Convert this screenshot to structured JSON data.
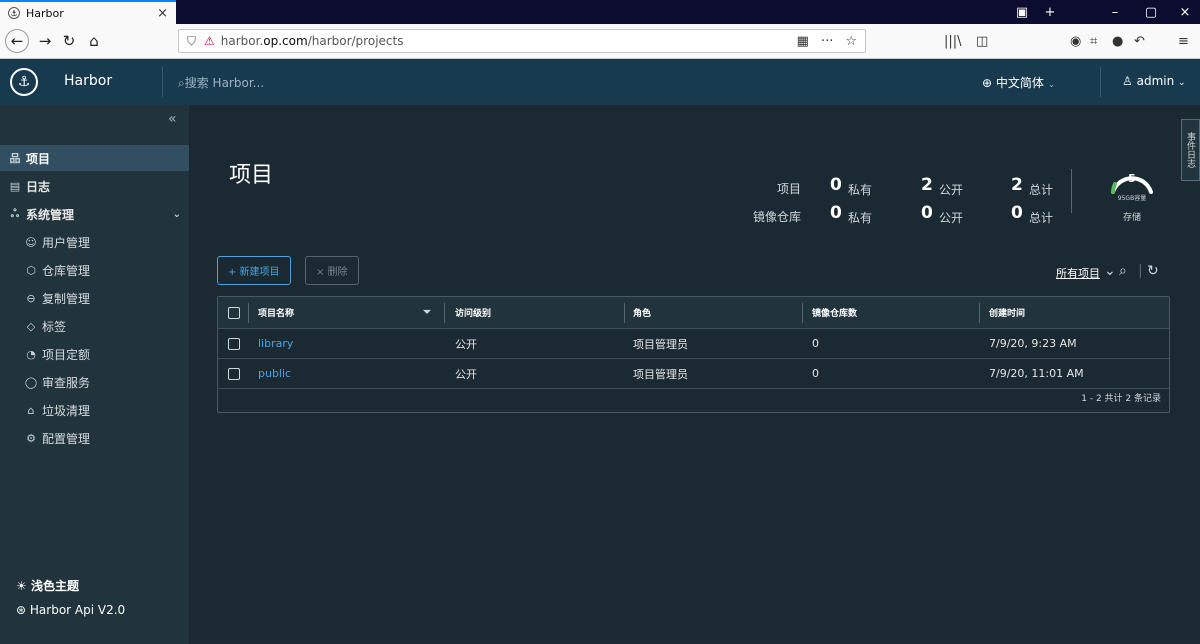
{
  "browser": {
    "tab_title": "Harbor",
    "tab_close": "×",
    "new_tab": "+",
    "url_prefix": "harbor.",
    "url_domain": "op.com",
    "url_path": "/harbor/projects",
    "minimize": "–",
    "restore": "▢",
    "close": "×"
  },
  "header": {
    "brand": "Harbor",
    "search_placeholder": "搜索 Harbor...",
    "language": "中文简体",
    "user": "admin"
  },
  "sidebar": {
    "items": [
      {
        "label": "项目",
        "icon": "projects-icon"
      },
      {
        "label": "日志",
        "icon": "logs-icon"
      },
      {
        "label": "系统管理",
        "icon": "admin-icon"
      },
      {
        "label": "用户管理",
        "icon": "users-icon"
      },
      {
        "label": "仓库管理",
        "icon": "registry-icon"
      },
      {
        "label": "复制管理",
        "icon": "replication-icon"
      },
      {
        "label": "标签",
        "icon": "tag-icon"
      },
      {
        "label": "项目定额",
        "icon": "quota-icon"
      },
      {
        "label": "审查服务",
        "icon": "shield-icon"
      },
      {
        "label": "垃圾清理",
        "icon": "trash-icon"
      },
      {
        "label": "配置管理",
        "icon": "gear-icon"
      }
    ],
    "theme": "浅色主题",
    "api": "Harbor Api V2.0"
  },
  "main": {
    "title": "项目",
    "side_tab": "事件日志",
    "stats": {
      "row1_label": "项目",
      "row2_label": "镜像仓库",
      "private_label": "私有",
      "public_label": "公开",
      "total_label": "总计",
      "projects": {
        "private": "0",
        "public": "2",
        "total": "2"
      },
      "repos": {
        "private": "0",
        "public": "0",
        "total": "0"
      }
    },
    "storage": {
      "value": "5",
      "sub": "95GB容量",
      "label": "存储"
    },
    "buttons": {
      "new": "+ 新建项目",
      "delete": "× 删除"
    },
    "filter": "所有项目",
    "table": {
      "headers": [
        "项目名称",
        "访问级别",
        "角色",
        "镜像仓库数",
        "创建时间"
      ],
      "rows": [
        [
          "library",
          "公开",
          "项目管理员",
          "0",
          "7/9/20, 9:23 AM"
        ],
        [
          "public",
          "公开",
          "项目管理员",
          "0",
          "7/9/20, 11:01 AM"
        ]
      ],
      "footer": "1 - 2 共计 2 条记录"
    }
  }
}
